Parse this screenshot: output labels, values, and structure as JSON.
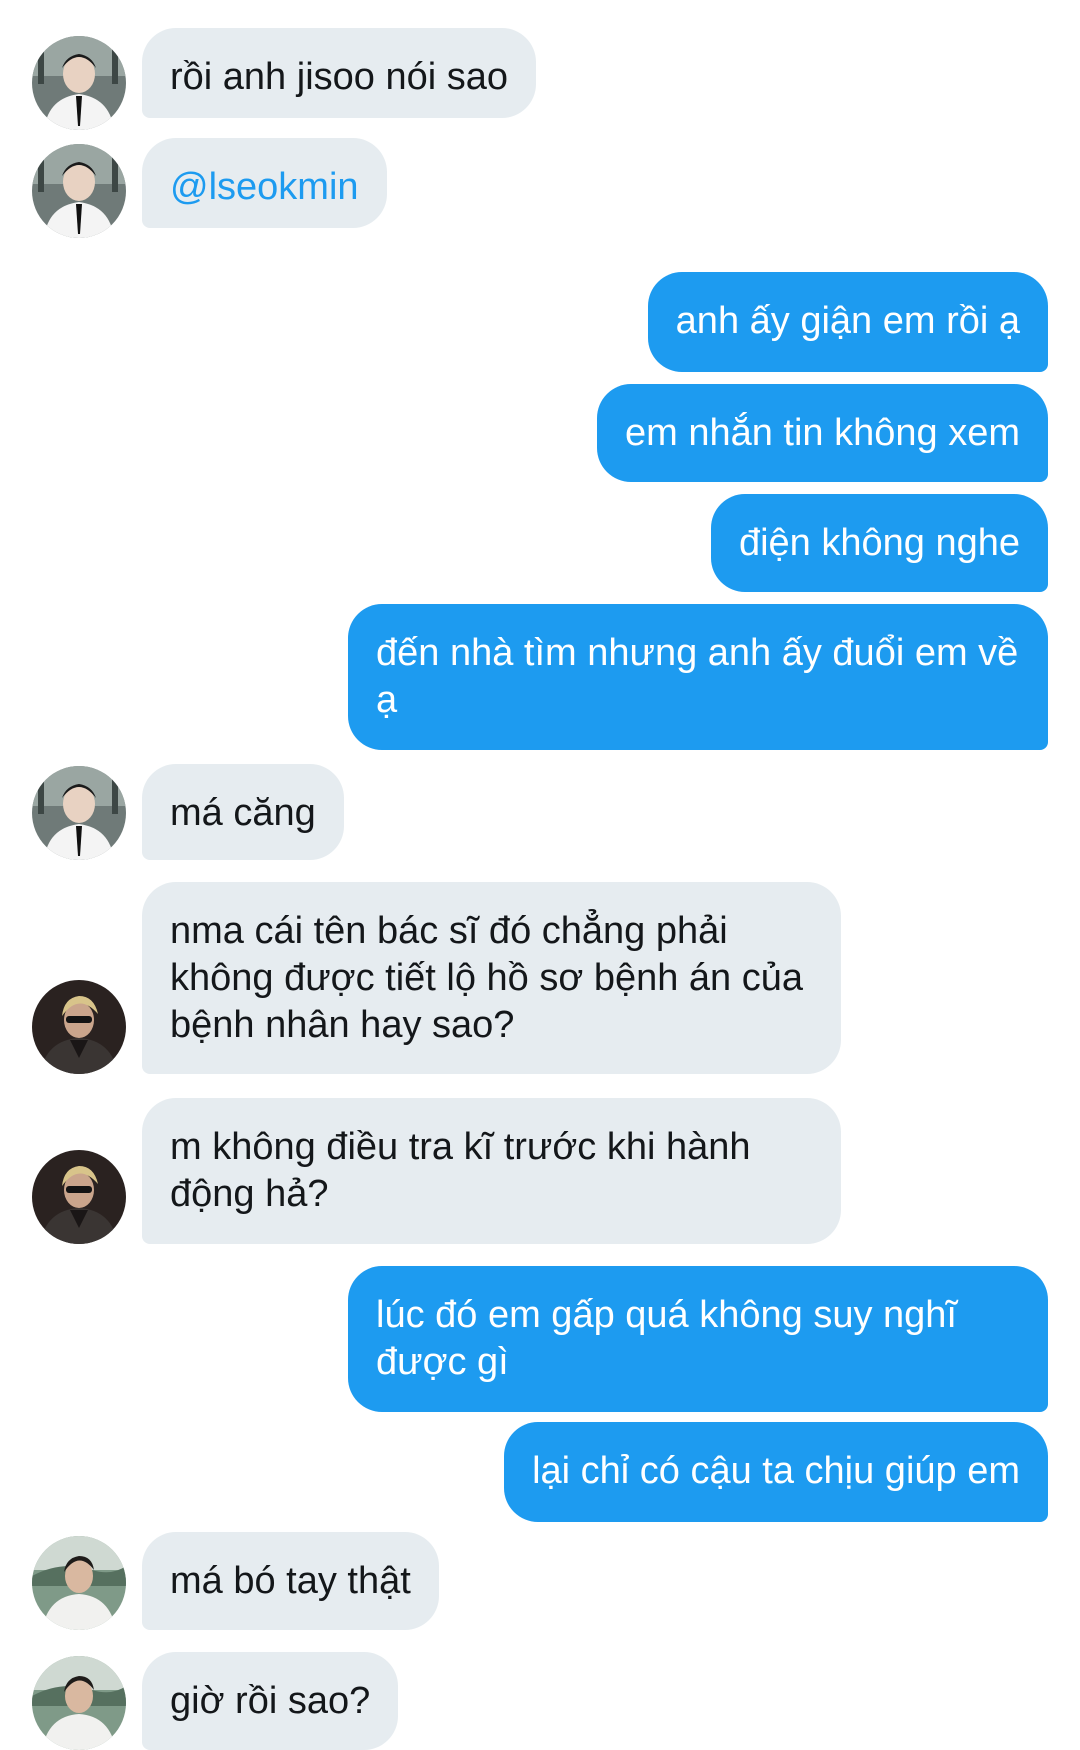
{
  "messages": [
    {
      "side": "in",
      "avatar": "user-a",
      "text": "rồi anh jisoo nói sao"
    },
    {
      "side": "in",
      "avatar": "user-a",
      "text": "@lseokmin",
      "mention": true
    },
    {
      "side": "out",
      "text": "anh ấy giận em rồi ạ"
    },
    {
      "side": "out",
      "text": "em nhắn tin không xem"
    },
    {
      "side": "out",
      "text": "điện không nghe"
    },
    {
      "side": "out",
      "text": "đến nhà tìm nhưng anh ấy đuổi em về ạ"
    },
    {
      "side": "in",
      "avatar": "user-a",
      "text": "má căng"
    },
    {
      "side": "in",
      "avatar": "user-b",
      "text": "nma cái tên bác sĩ đó chẳng phải không được tiết lộ hồ sơ bệnh án của bệnh nhân hay sao?"
    },
    {
      "side": "in",
      "avatar": "user-b",
      "text": "m không điều tra kĩ trước khi hành động hả?"
    },
    {
      "side": "out",
      "text": "lúc đó em gấp quá không suy nghĩ được gì"
    },
    {
      "side": "out",
      "text": "lại chỉ có cậu ta chịu giúp em"
    },
    {
      "side": "in",
      "avatar": "user-c",
      "text": "má bó tay thật"
    },
    {
      "side": "in",
      "avatar": "user-c",
      "text": "giờ rồi sao?"
    }
  ],
  "colors": {
    "incoming_bg": "#e6ecf0",
    "outgoing_bg": "#1d9bf0",
    "mention": "#1d9bf0"
  }
}
